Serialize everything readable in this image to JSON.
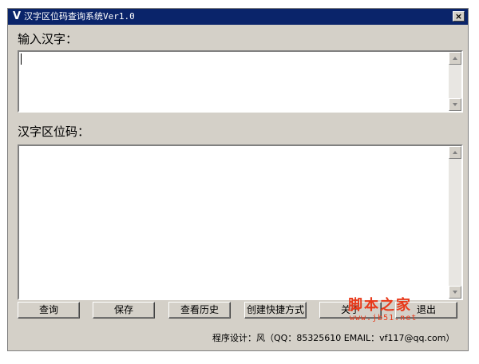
{
  "window": {
    "title": "汉字区位码查询系统Ver1.0",
    "app_icon": "V",
    "close_glyph": "×"
  },
  "input_section": {
    "label": "输入汉字：",
    "value": ""
  },
  "output_section": {
    "label": "汉字区位码：",
    "value": ""
  },
  "buttons": {
    "query": "查询",
    "save": "保存",
    "history": "查看历史",
    "shortcut": "创建快捷方式",
    "about": "关于",
    "exit": "退出"
  },
  "footer": {
    "credit": "程序设计：风（QQ：85325610  EMAIL：vf117@qq.com）"
  },
  "watermark": {
    "logo": "脚本之家",
    "url": "www.jb51.net"
  },
  "colors": {
    "titlebar": "#0a246a",
    "face": "#d4d0c8",
    "watermark": "#e8391a"
  }
}
